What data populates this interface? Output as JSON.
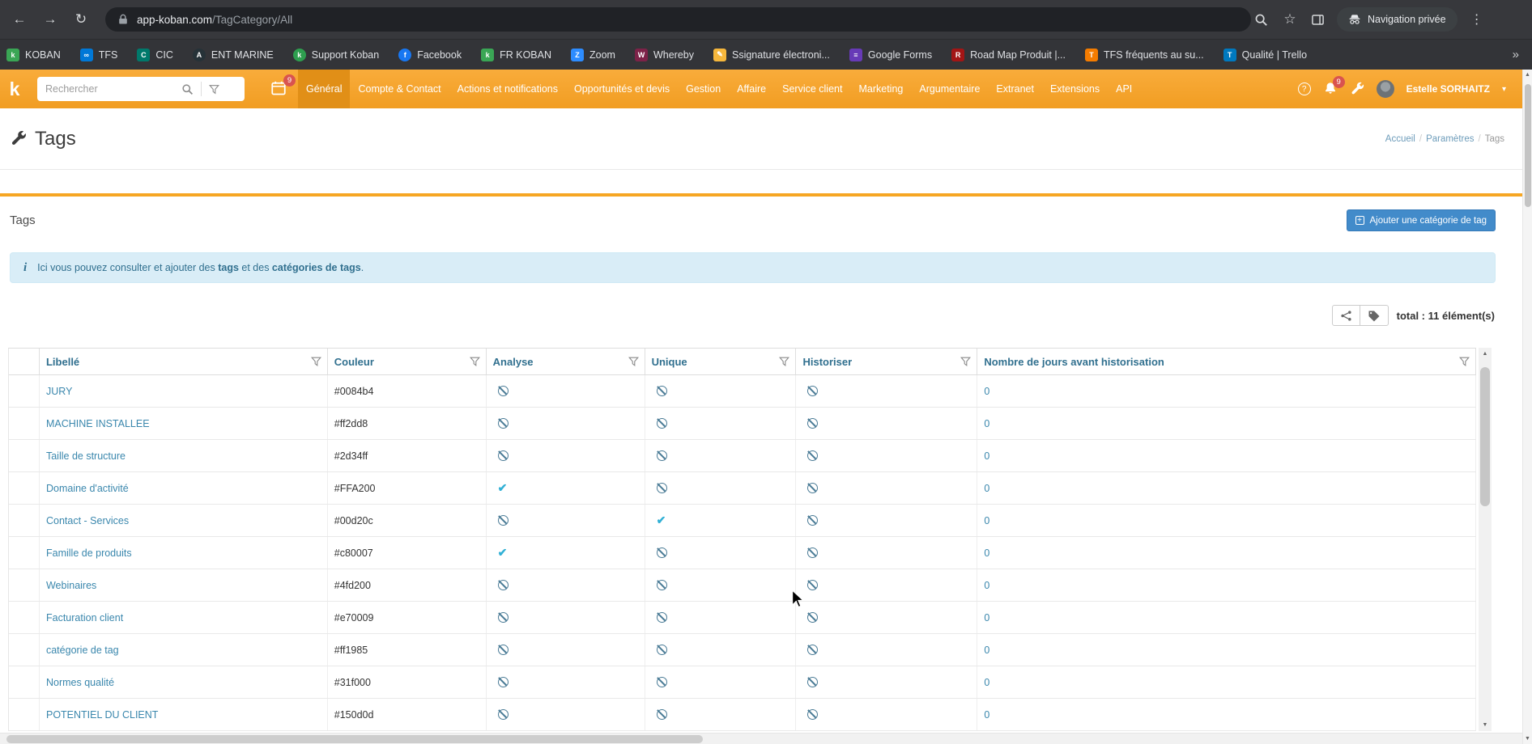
{
  "browser": {
    "url_domain": "app-koban.com",
    "url_path": "/TagCategory/All",
    "private_label": "Navigation privée",
    "overflow_chevron": "»",
    "bookmarks": [
      {
        "label": "KOBAN",
        "color": "#3aa655",
        "letter": "k"
      },
      {
        "label": "TFS",
        "color": "#0078d7",
        "letter": "∞"
      },
      {
        "label": "CIC",
        "color": "#00796b",
        "letter": "C"
      },
      {
        "label": "ENT MARINE",
        "color": "#263238",
        "letter": "A",
        "round": true
      },
      {
        "label": "Support Koban",
        "color": "#2e9e4f",
        "letter": "k",
        "round": true
      },
      {
        "label": "Facebook",
        "color": "#1877f2",
        "letter": "f",
        "round": true
      },
      {
        "label": "FR KOBAN",
        "color": "#3aa655",
        "letter": "k"
      },
      {
        "label": "Zoom",
        "color": "#2d8cff",
        "letter": "Z"
      },
      {
        "label": "Whereby",
        "color": "#7d2248",
        "letter": "W"
      },
      {
        "label": "Ssignature électroni...",
        "color": "#f6b73c",
        "letter": "✎"
      },
      {
        "label": "Google Forms",
        "color": "#673ab7",
        "letter": "≡"
      },
      {
        "label": "Road Map Produit |...",
        "color": "#a31515",
        "letter": "R"
      },
      {
        "label": "TFS fréquents au su...",
        "color": "#f57c00",
        "letter": "T"
      },
      {
        "label": "Qualité | Trello",
        "color": "#0079bf",
        "letter": "T"
      }
    ]
  },
  "app_header": {
    "logo_letter": "k",
    "search_placeholder": "Rechercher",
    "calendar_badge": "9",
    "bell_badge": "9",
    "nav_items": [
      "Général",
      "Compte & Contact",
      "Actions et notifications",
      "Opportunités et devis",
      "Gestion",
      "Affaire",
      "Service client",
      "Marketing",
      "Argumentaire",
      "Extranet",
      "Extensions",
      "API"
    ],
    "active_nav": "Général",
    "user_name": "Estelle SORHAITZ"
  },
  "page": {
    "title": "Tags",
    "breadcrumb": [
      "Accueil",
      "Paramètres",
      "Tags"
    ]
  },
  "panel": {
    "title": "Tags",
    "add_button_label": "Ajouter une catégorie de tag",
    "info": {
      "pre": "Ici vous pouvez consulter et ajouter des ",
      "bold1": "tags",
      "mid": " et des ",
      "bold2": "catégories de tags",
      "post": "."
    },
    "total_label": "total : 11 élément(s)"
  },
  "table": {
    "headers": [
      "Libellé",
      "Couleur",
      "Analyse",
      "Unique",
      "Historiser",
      "Nombre de jours avant historisation"
    ],
    "rows": [
      {
        "label": "JURY",
        "color": "#0084b4",
        "analyse": false,
        "unique": false,
        "historiser": false,
        "days": "0"
      },
      {
        "label": "MACHINE INSTALLEE",
        "color": "#ff2dd8",
        "analyse": false,
        "unique": false,
        "historiser": false,
        "days": "0"
      },
      {
        "label": "Taille de structure",
        "color": "#2d34ff",
        "analyse": false,
        "unique": false,
        "historiser": false,
        "days": "0"
      },
      {
        "label": "Domaine d'activité",
        "color": "#FFA200",
        "analyse": true,
        "unique": false,
        "historiser": false,
        "days": "0"
      },
      {
        "label": "Contact - Services",
        "color": "#00d20c",
        "analyse": false,
        "unique": true,
        "historiser": false,
        "days": "0"
      },
      {
        "label": "Famille de produits",
        "color": "#c80007",
        "analyse": true,
        "unique": false,
        "historiser": false,
        "days": "0"
      },
      {
        "label": "Webinaires",
        "color": "#4fd200",
        "analyse": false,
        "unique": false,
        "historiser": false,
        "days": "0"
      },
      {
        "label": "Facturation client",
        "color": "#e70009",
        "analyse": false,
        "unique": false,
        "historiser": false,
        "days": "0"
      },
      {
        "label": "catégorie de tag",
        "color": "#ff1985",
        "analyse": false,
        "unique": false,
        "historiser": false,
        "days": "0"
      },
      {
        "label": "Normes qualité",
        "color": "#31f000",
        "analyse": false,
        "unique": false,
        "historiser": false,
        "days": "0"
      },
      {
        "label": "POTENTIEL DU CLIENT",
        "color": "#150d0d",
        "analyse": false,
        "unique": false,
        "historiser": false,
        "days": "0"
      }
    ]
  },
  "colors": {
    "accent_orange": "#f6a623",
    "link_blue": "#3a87ad",
    "button_blue": "#428bca",
    "alert_bg": "#d9edf7",
    "alert_text": "#31708f",
    "badge_red": "#d9534f"
  }
}
